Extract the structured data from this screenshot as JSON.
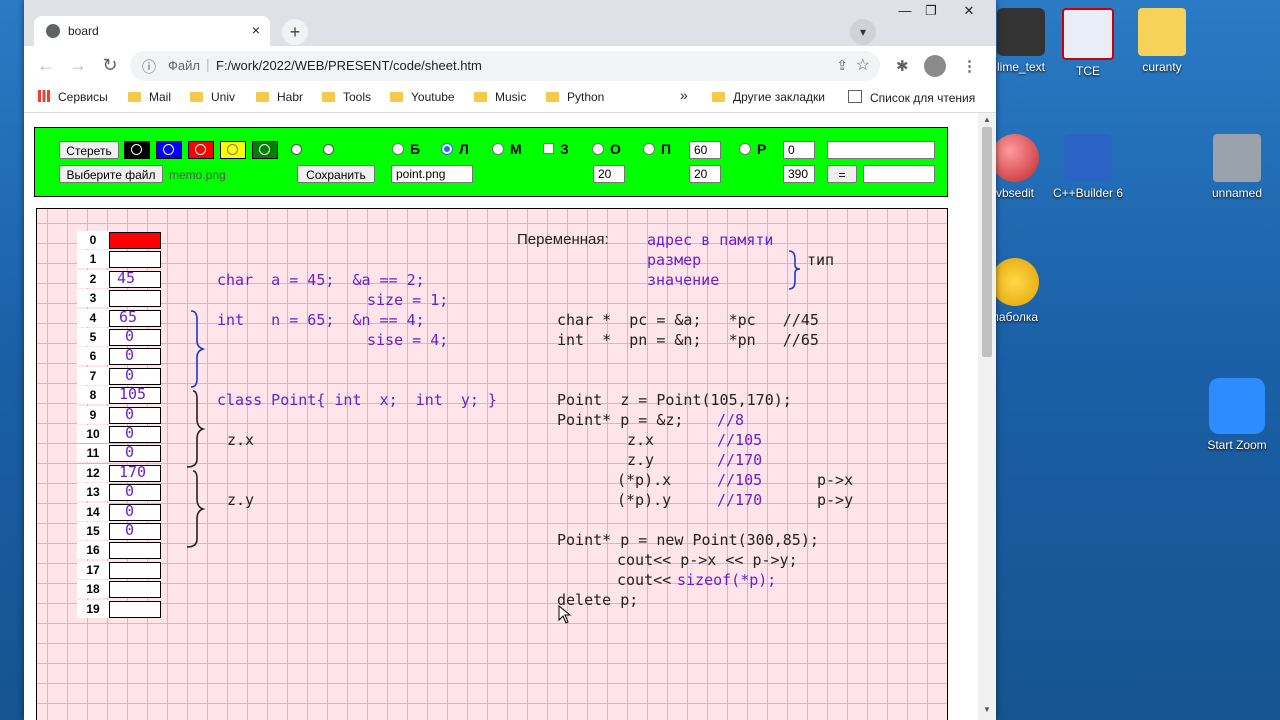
{
  "desktop": {
    "icons": [
      {
        "label": "lime_text"
      },
      {
        "label": "TCE"
      },
      {
        "label": "curanty"
      },
      {
        "label": "vbsedit"
      },
      {
        "label": "C++Builder 6"
      },
      {
        "label": "unnamed"
      },
      {
        "label": "лаболка"
      },
      {
        "label": "Start Zoom"
      }
    ]
  },
  "browser": {
    "tab_title": "board",
    "tab_close": "×",
    "new_tab": "+",
    "window_controls": {
      "minimize": "—",
      "restore": "❐",
      "close": "✕"
    },
    "address": {
      "scheme": "Файл",
      "url": "F:/work/2022/WEB/PRESENT/code/sheet.htm"
    },
    "bookmarks": [
      "Сервисы",
      "Mail",
      "Univ",
      "Habr",
      "Tools",
      "Youtube",
      "Music",
      "Python"
    ],
    "bookmarks_more": "»",
    "other_bookmarks": "Другие закладки",
    "reading_list": "Список для чтения"
  },
  "panel": {
    "erase_label": "Стереть",
    "choose_file_label": "Выберите файл",
    "file_name": "memo.png",
    "save_label": "Сохранить",
    "save_name": "point.png",
    "swatches": [
      "#000000",
      "#0000ff",
      "#ff0000",
      "#ffff00",
      "#008000",
      "#ffffff",
      "#ffffff"
    ],
    "modes": [
      {
        "label": "Б",
        "selected": false
      },
      {
        "label": "Л",
        "selected": true
      },
      {
        "label": "М",
        "selected": false
      },
      {
        "label": "З",
        "selected": false
      },
      {
        "label": "О",
        "selected": false
      },
      {
        "label": "П",
        "selected": false
      },
      {
        "label": "Р",
        "selected": false
      }
    ],
    "z_checked": false,
    "field_o": "20",
    "field_p_top": "60",
    "field_p_bottom": "20",
    "field_r_top": "0",
    "field_r_bottom": "390",
    "equals_label": "=",
    "text_top": "",
    "text_bottom": ""
  },
  "board": {
    "memory_indices": [
      "0",
      "1",
      "2",
      "3",
      "4",
      "5",
      "6",
      "7",
      "8",
      "9",
      "10",
      "11",
      "12",
      "13",
      "14",
      "15",
      "16",
      "17",
      "18",
      "19"
    ],
    "memory_values": [
      "",
      "",
      "45",
      "",
      "65",
      "0",
      "0",
      "0",
      "105",
      "0",
      "0",
      "0",
      "170",
      "0",
      "0",
      "0",
      "",
      "",
      "",
      ""
    ],
    "cell0_color": "#ff0000",
    "header": {
      "label": "Переменная:",
      "addr": "адрес в памяти",
      "size": "размер",
      "value": "значение",
      "type": "тип"
    },
    "left_code": {
      "char_line": "char  a = 45;  &a == 2;",
      "char_size": "size = 1;",
      "int_line": "int   n = 65;  &n == 4;",
      "int_size": "sise = 4;",
      "class_line": "class Point{ int  x;  int  y; }",
      "zx": "z.x",
      "zy": "z.y"
    },
    "right_code": {
      "pc_line": "char *  pc = &a;   *pc   //45",
      "pn_line": "int  *  pn = &n;   *pn   //65",
      "z_line": "Point  z = Point(105,170);",
      "p_line": "Point* p = &z;",
      "p_comment": "//8",
      "zx_line": "z.x",
      "zx_comment": "//105",
      "zy_line": "z.y",
      "zy_comment": "//170",
      "px_line": "(*p).x",
      "px_comment": "//105",
      "px_arrow": "p->x",
      "py_line": "(*p).y",
      "py_comment": "//170",
      "py_arrow": "p->y",
      "new_line": "Point* p = new Point(300,85);",
      "cout1": "cout<< p->x << p->y;",
      "cout2_a": "cout<<",
      "cout2_b": "sizeof(*p);",
      "delete_line": "delete p;"
    }
  }
}
